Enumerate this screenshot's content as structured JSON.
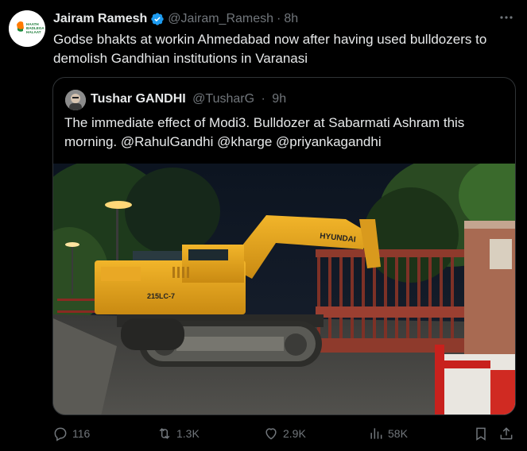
{
  "tweet": {
    "author_name": "Jairam Ramesh",
    "handle": "@Jairam_Ramesh",
    "dot": "·",
    "time": "8h",
    "text": "Godse bhakts at workin Ahmedabad now after having used bulldozers to demolish Gandhian institutions in Varanasi",
    "avatar_logo_text": [
      "HAATH",
      "BADLEGA",
      "HALAAT"
    ],
    "more_icon": "more-icon"
  },
  "quoted_tweet": {
    "author_name": "Tushar GANDHI",
    "handle": "@TusharG",
    "dot": "·",
    "time": "9h",
    "text": "The immediate effect of Modi3. Bulldozer at Sabarmati Ashram this morning. @RahulGandhi @kharge @priyankagandhi",
    "photo_texts": {
      "machine_brand": "HYUNDAI",
      "model": "215LC-7"
    }
  },
  "actions": {
    "replies": "116",
    "reposts": "1.3K",
    "likes": "2.9K",
    "views": "58K"
  },
  "colors": {
    "background": "#000000",
    "text": "#e7e9ea",
    "muted": "#71767b",
    "border": "#2f3336",
    "verified": "#1d9bf0"
  }
}
